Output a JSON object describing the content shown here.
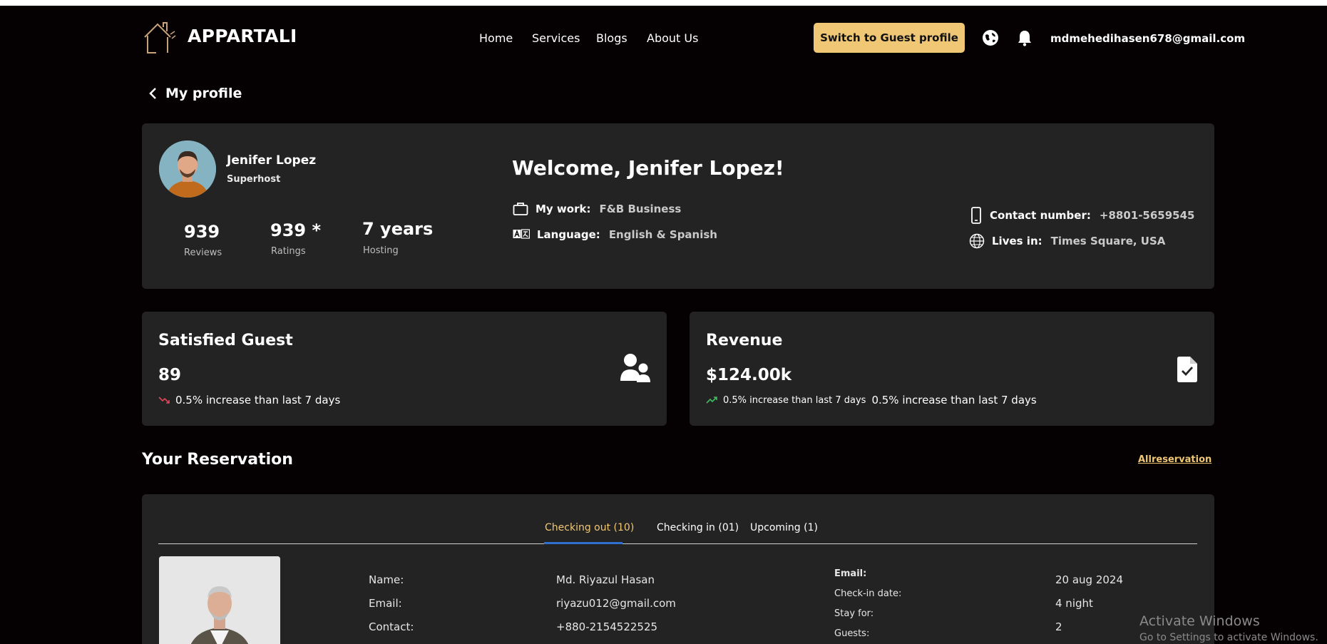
{
  "brand": {
    "name": "APPARTALI"
  },
  "nav": {
    "home": "Home",
    "services": "Services",
    "blogs": "Blogs",
    "about": "About Us"
  },
  "header": {
    "guest_button": "Switch to Guest profile",
    "user_email": "mdmehedihasen678@gmail.com"
  },
  "back": {
    "label": "My profile"
  },
  "profile": {
    "name": "Jenifer Lopez",
    "role": "Superhost",
    "stats": [
      {
        "value": "939",
        "label": "Reviews"
      },
      {
        "value": "939 *",
        "label": "Ratings"
      },
      {
        "value": "7 years",
        "label": "Hosting"
      }
    ],
    "welcome": "Welcome, Jenifer Lopez!",
    "work_label": "My work:",
    "work_value": "F&B Business",
    "language_label": "Language:",
    "language_value": "English & Spanish",
    "contact_label": "Contact number:",
    "contact_value": "+8801-5659545",
    "lives_label": "Lives in:",
    "lives_value": "Times Square, USA"
  },
  "kpis": {
    "guest": {
      "title": "Satisfied Guest",
      "value": "89",
      "trend": "0.5% increase than last 7 days",
      "trend_color": "#e0455a"
    },
    "revenue": {
      "title": "Revenue",
      "value": "$124.00k",
      "trend_small": "0.5% increase than last 7 days",
      "trend": "0.5% increase than last 7 days",
      "trend_color": "#3fbf60"
    }
  },
  "reservation": {
    "title": "Your Reservation",
    "all_link": "Allreservation",
    "tabs": [
      "Checking out (10)",
      "Checking in (01)",
      "Upcoming (1)"
    ],
    "active_tab_color": "#f0c774",
    "left": {
      "labels": [
        "Name:",
        "Email:",
        "Contact:"
      ],
      "values": [
        "Md. Riyazul Hasan",
        "riyazu012@gmail.com",
        "+880-2154522525"
      ]
    },
    "right": {
      "labels": [
        "Email:",
        "Check-in date:",
        "Stay for:",
        "Guests:"
      ],
      "values": [
        "20 aug 2024",
        "4 night",
        "2"
      ]
    }
  },
  "watermark": {
    "line1": "Activate Windows",
    "line2": "Go to Settings to activate Windows."
  }
}
